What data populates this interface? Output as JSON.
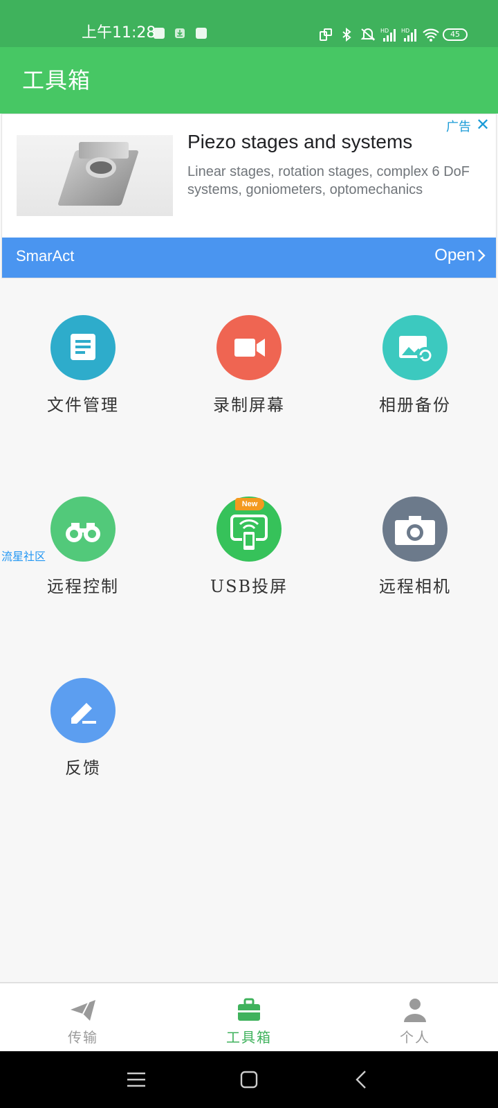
{
  "status_bar": {
    "time": "上午11:28",
    "battery": "45",
    "colors": {
      "background": "#3fb25c"
    }
  },
  "app_bar": {
    "title": "工具箱",
    "color": "#47c764"
  },
  "ad": {
    "badge": "广告",
    "headline": "Piezo stages and systems",
    "description": "Linear stages, rotation stages, complex 6 DoF systems, goniometers, optomechanics",
    "advertiser": "SmarAct",
    "cta": "Open",
    "cta_color": "#4a95f0"
  },
  "tools": [
    {
      "label": "文件管理",
      "icon": "file-icon",
      "color": "#2eaccb"
    },
    {
      "label": "录制屏幕",
      "icon": "video-camera-icon",
      "color": "#ef6552"
    },
    {
      "label": "相册备份",
      "icon": "photo-sync-icon",
      "color": "#3cc9bf"
    },
    {
      "label": "远程控制",
      "icon": "binoculars-icon",
      "color": "#52c97a"
    },
    {
      "label": "USB投屏",
      "icon": "cast-screen-icon",
      "color": "#36c25a",
      "badge": "New"
    },
    {
      "label": "远程相机",
      "icon": "camera-icon",
      "color": "#6c7a8b"
    },
    {
      "label": "反馈",
      "icon": "edit-pen-icon",
      "color": "#5c9ef0"
    }
  ],
  "floating_label": "流星社区",
  "bottom_nav": [
    {
      "label": "传输",
      "icon": "send-icon",
      "active": false
    },
    {
      "label": "工具箱",
      "icon": "toolbox-icon",
      "active": true
    },
    {
      "label": "个人",
      "icon": "person-icon",
      "active": false
    }
  ],
  "system_nav": [
    "menu-icon",
    "home-icon",
    "back-icon"
  ]
}
